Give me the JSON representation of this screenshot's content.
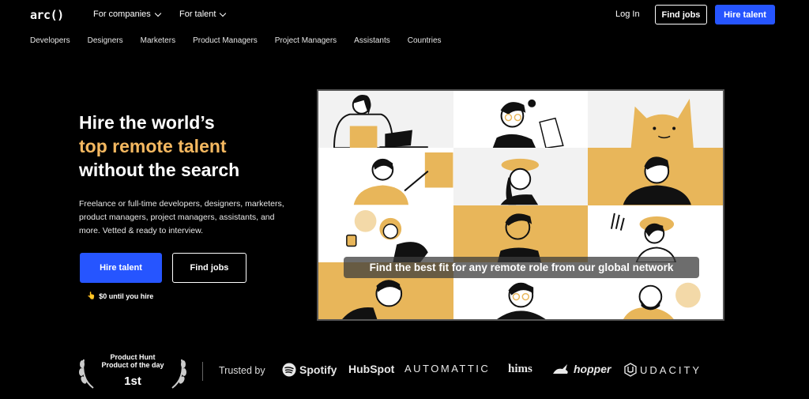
{
  "nav": {
    "logo": "arc()",
    "for_companies": "For companies",
    "for_talent": "For talent",
    "login": "Log In",
    "find_jobs": "Find jobs",
    "hire_talent": "Hire talent"
  },
  "subnav": [
    "Developers",
    "Designers",
    "Marketers",
    "Product Managers",
    "Project Managers",
    "Assistants",
    "Countries"
  ],
  "hero": {
    "line1": "Hire the world’s",
    "line2": "top remote talent",
    "line3": "without the search",
    "description": "Freelance or full-time developers, designers, marketers, product managers, project managers, assistants, and more. Vetted & ready to interview.",
    "hire_button": "Hire talent",
    "jobs_button": "Find jobs",
    "note_icon": "👆",
    "note": "$0 until you hire"
  },
  "media": {
    "caption": "Find the best fit for any remote role from our global network"
  },
  "award": {
    "line1": "Product Hunt",
    "line2": "Product of the day",
    "rank": "1st"
  },
  "trusted": {
    "label": "Trusted by",
    "brands": [
      "Spotify",
      "HubSpot",
      "AUTOMATTIC",
      "hims",
      "hopper",
      "UDACITY"
    ]
  },
  "colors": {
    "accent_blue": "#2655ff",
    "highlight": "#f4b860",
    "tile_yellow": "#e8b65a",
    "tile_light": "#f2f2f2"
  }
}
